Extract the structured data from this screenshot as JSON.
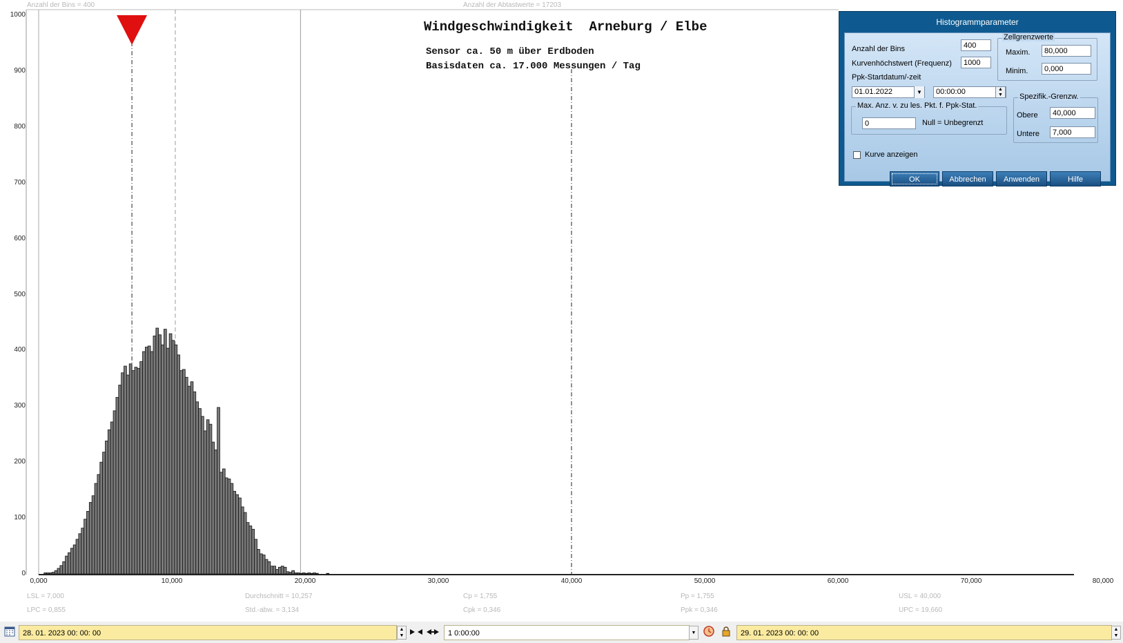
{
  "header": {
    "bins_info": "Anzahl der Bins =   400",
    "samples_info": "Anzahl der Abtastwerte = 17203"
  },
  "chart_data": {
    "type": "bar",
    "title": "Windgeschwindigkeit  Arneburg / Elbe",
    "subtitle_lines": [
      "Sensor ca. 50 m über Erdboden",
      "Basisdaten ca. 17.000 Messungen / Tag"
    ],
    "xlim": [
      0,
      80
    ],
    "ylim": [
      0,
      1000
    ],
    "x_ticks": [
      "0,000",
      "10,000",
      "20,000",
      "30,000",
      "40,000",
      "50,000",
      "60,000",
      "70,000",
      "80,000"
    ],
    "y_ticks": [
      "0",
      "100",
      "200",
      "300",
      "400",
      "500",
      "600",
      "700",
      "800",
      "900",
      "1000"
    ],
    "bin_width": 0.2,
    "bins_start": 0.4,
    "values": [
      2,
      2,
      2,
      3,
      6,
      10,
      15,
      22,
      32,
      38,
      46,
      52,
      62,
      72,
      82,
      98,
      112,
      128,
      140,
      162,
      178,
      200,
      218,
      238,
      258,
      272,
      292,
      316,
      338,
      360,
      372,
      356,
      376,
      364,
      370,
      368,
      380,
      398,
      406,
      408,
      398,
      426,
      440,
      428,
      410,
      438,
      404,
      430,
      418,
      410,
      392,
      364,
      366,
      352,
      336,
      344,
      326,
      308,
      296,
      282,
      256,
      276,
      268,
      236,
      222,
      298,
      182,
      188,
      172,
      170,
      162,
      148,
      142,
      136,
      120,
      110,
      92,
      86,
      80,
      62,
      44,
      36,
      34,
      26,
      22,
      14,
      14,
      8,
      12,
      14,
      12,
      4,
      3,
      6,
      2,
      2,
      1,
      2,
      1,
      2,
      1,
      2,
      1,
      0,
      0,
      0,
      1
    ],
    "vlines": {
      "lsl": 7.0,
      "mean": 10.257,
      "usl": 40.0,
      "upper_bound": 19.66,
      "left_bound": 0.0
    },
    "grid": false
  },
  "stats": {
    "lsl": "LSL = 7,000",
    "lpc": "LPC = 0,855",
    "mean": "Durchschnitt = 10,257",
    "std": "Std.-abw. = 3,134",
    "cp": "Cp = 1,755",
    "cpk": "Cpk = 0,346",
    "pp": "Pp = 1,755",
    "ppk": "Ppk = 0,346",
    "usl": "USL = 40,000",
    "upc": "UPC = 19,660"
  },
  "dialog": {
    "title": "Histogrammparameter",
    "bins_label": "Anzahl der Bins",
    "bins_value": "400",
    "curve_max_label": "Kurvenhöchstwert (Frequenz)",
    "curve_max_value": "1000",
    "ppk_start_label": "Ppk-Startdatum/-zeit",
    "start_date": "01.01.2022",
    "start_time": "00:00:00",
    "cell_limits_title": "Zellgrenzwerte",
    "max_label": "Maxim.",
    "max_value": "80,000",
    "min_label": "Minim.",
    "min_value": "0,000",
    "maxpts_title": "Max. Anz. v. zu les. Pkt. f. Ppk-Stat.",
    "maxpts_value": "0",
    "maxpts_hint": "Null = Unbegrenzt",
    "spec_title": "Spezifik.-Grenzw.",
    "upper_label": "Obere",
    "upper_value": "40,000",
    "lower_label": "Untere",
    "lower_value": "7,000",
    "show_curve_label": "Kurve anzeigen",
    "show_curve_checked": false,
    "ok_label": "OK",
    "cancel_label": "Abbrechen",
    "apply_label": "Anwenden",
    "help_label": "Hilfe",
    "colors": {
      "titlebar": "#0e5a90",
      "button": "#1a4f82"
    }
  },
  "bottom_bar": {
    "start": "28. 01. 2023    00: 00: 00",
    "interval": "1 0:00:00",
    "end": "29. 01. 2023    00: 00: 00"
  },
  "colors": {
    "marker": "#e01010",
    "bar_fill": "#7a7a7a",
    "bar_stroke": "#111111"
  }
}
